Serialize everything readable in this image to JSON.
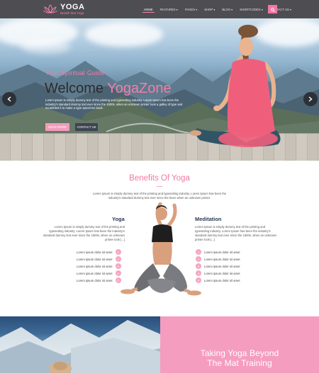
{
  "brand": {
    "name": "YOGA",
    "tagline": "Breath that Yoga"
  },
  "nav": {
    "items": [
      {
        "label": "HOME",
        "active": true
      },
      {
        "label": "FEATURES ▾",
        "active": false
      },
      {
        "label": "PAGES ▾",
        "active": false
      },
      {
        "label": "SHOP ▾",
        "active": false
      },
      {
        "label": "BLOG ▾",
        "active": false
      },
      {
        "label": "SHORTCODES ▾",
        "active": false
      },
      {
        "label": "CONTACT US ▾",
        "active": false
      }
    ],
    "search_icon": "search-icon"
  },
  "hero": {
    "subtitle": "Your Spiritual Guide",
    "title_prefix": "Welcome ",
    "title_highlight": "YogaZone",
    "text": "Lorem Ipsum is simply dummy text of the printing and typesetting industry. Lorem Ipsum has been the industry's standard dummy text ever since the 1500s, when an unknown printer took a galley of type and scrambled it to make a type specimen book.",
    "read_more": "READ MORE",
    "contact": "CONTACT US"
  },
  "benefits": {
    "title": "Benefits Of Yoga",
    "intro": "Lorem Ipsum is simply dummy text of the printing and typesetting industry. Lorem Ipsum has been the industry's standard dummy text ever since the been when an unknown printer.",
    "yoga": {
      "title": "Yoga",
      "text": "Lorem Ipsum is simply dummy text of the printing and typesetting industry. Lorem Ipsum has been the industry's standard dummy text ever since the 1500s, when an unknown printer took [...]",
      "items": [
        "Lorem ipsum dolor sit amet",
        "Lorem ipsum dolor sit amet",
        "Lorem ipsum dolor sit amet",
        "Lorem ipsum dolor sit amet",
        "Lorem ipsum dolor sit amet"
      ],
      "numbers": [
        "1",
        "2",
        "3",
        "4",
        "5"
      ]
    },
    "meditation": {
      "title": "Meditation",
      "text": "Lorem Ipsum is simply dummy text of the printing and typesetting industry. Lorem Ipsum has been the industry's standard dummy text ever since the 1500s, when an unknown printer took [...]",
      "items": [
        "Lorem ipsum dolor sit amet",
        "Lorem ipsum dolor sit amet",
        "Lorem ipsum dolor sit amet",
        "Lorem ipsum dolor sit amet",
        "Lorem ipsum dolor sit amet"
      ],
      "numbers": [
        "1",
        "2",
        "3",
        "4",
        "5"
      ]
    }
  },
  "promo": {
    "line1": "Taking Yoga Beyond",
    "line2": "The Mat Training"
  },
  "colors": {
    "accent_pink": "#f277a5",
    "nav_bg": "#4e4e52",
    "dark_button": "#3c4450",
    "heading_navy": "#2a3a52"
  }
}
